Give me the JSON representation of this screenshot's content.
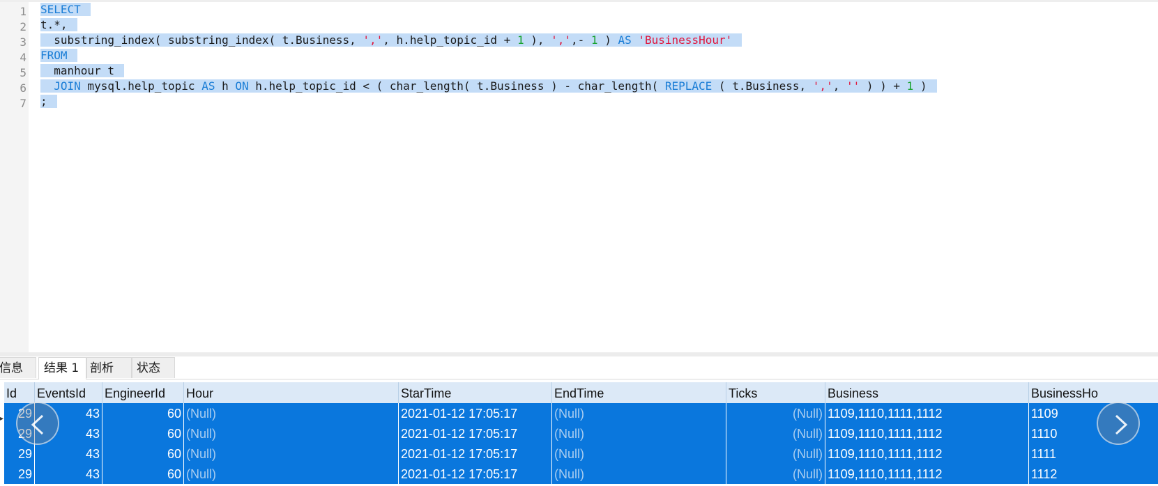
{
  "editor": {
    "line_numbers": [
      "1",
      "2",
      "3",
      "4",
      "5",
      "6",
      "7"
    ]
  },
  "tabs": [
    "信息",
    "结果 1",
    "剖析",
    "状态"
  ],
  "columns": [
    "Id",
    "EventsId",
    "EngineerId",
    "Hour",
    "StarTime",
    "EndTime",
    "Ticks",
    "Business",
    "BusinessHo"
  ],
  "rows": [
    [
      "29",
      "43",
      "60",
      "(Null)",
      "2021-01-12 17:05:17",
      "(Null)",
      "(Null)",
      "1109,1110,1111,1112",
      "1109"
    ],
    [
      "29",
      "43",
      "60",
      "(Null)",
      "2021-01-12 17:05:17",
      "(Null)",
      "(Null)",
      "1109,1110,1111,1112",
      "1110"
    ],
    [
      "29",
      "43",
      "60",
      "(Null)",
      "2021-01-12 17:05:17",
      "(Null)",
      "(Null)",
      "1109,1110,1111,1112",
      "1111"
    ],
    [
      "29",
      "43",
      "60",
      "(Null)",
      "2021-01-12 17:05:17",
      "(Null)",
      "(Null)",
      "1109,1110,1111,1112",
      "1112"
    ]
  ],
  "colors": {
    "selection": "#c3dcf7",
    "keyword": "#1a7dd6",
    "string": "#e0163c",
    "number": "#17a22e",
    "row_selected": "#0a77dd",
    "header_bg": "#dce9f7"
  },
  "icons": {
    "prev": "chevron-left-icon",
    "next": "chevron-right-icon"
  }
}
